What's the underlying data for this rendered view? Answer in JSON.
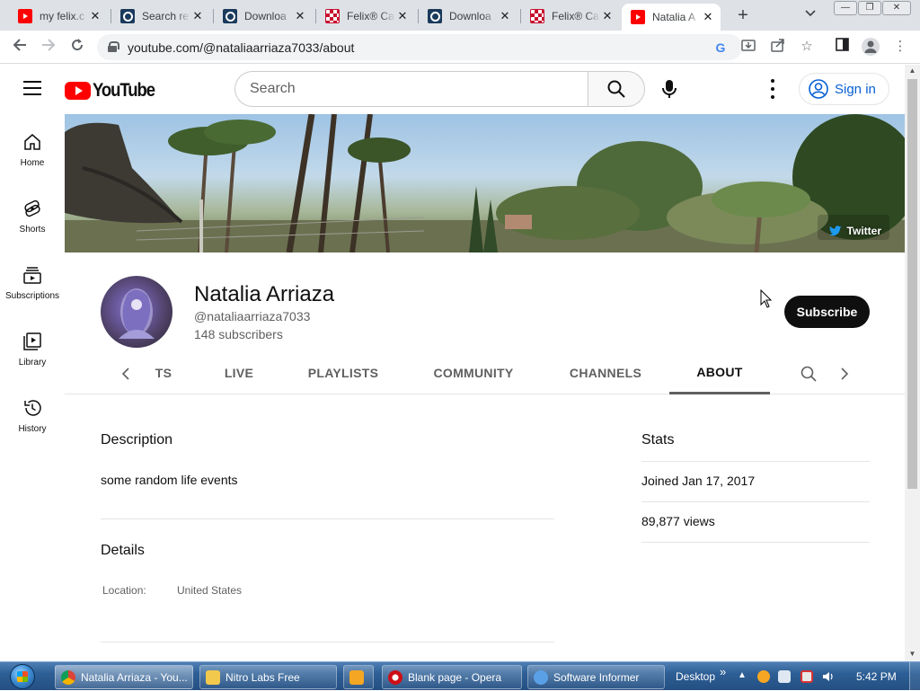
{
  "browser": {
    "tabs": [
      {
        "title": "my felix.c",
        "favicon": "youtube-icon"
      },
      {
        "title": "Search re",
        "favicon": "search-site-icon"
      },
      {
        "title": "Downloa",
        "favicon": "search-site-icon"
      },
      {
        "title": "Felix® Ca",
        "favicon": "felix-icon"
      },
      {
        "title": "Downloa",
        "favicon": "search-site-icon"
      },
      {
        "title": "Felix® Ca",
        "favicon": "felix-icon"
      },
      {
        "title": "Natalia A",
        "favicon": "youtube-icon",
        "active": true
      }
    ],
    "url": "youtube.com/@nataliaarriaza7033/about"
  },
  "youtube": {
    "logo_text": "YouTube",
    "search_placeholder": "Search",
    "signin_label": "Sign in",
    "sidebar": [
      {
        "label": "Home",
        "icon": "home-icon"
      },
      {
        "label": "Shorts",
        "icon": "shorts-icon"
      },
      {
        "label": "Subscriptions",
        "icon": "subscriptions-icon"
      },
      {
        "label": "Library",
        "icon": "library-icon"
      },
      {
        "label": "History",
        "icon": "history-icon"
      }
    ]
  },
  "channel": {
    "banner_link": "Twitter",
    "name": "Natalia Arriaza",
    "handle": "@nataliaarriaza7033",
    "subscribers": "148 subscribers",
    "subscribe_label": "Subscribe",
    "tabs": [
      "TS",
      "LIVE",
      "PLAYLISTS",
      "COMMUNITY",
      "CHANNELS",
      "ABOUT"
    ],
    "active_tab": "ABOUT"
  },
  "about": {
    "description_title": "Description",
    "description": "some random life events",
    "details_title": "Details",
    "location_label": "Location:",
    "location_value": "United States",
    "stats_title": "Stats",
    "joined": "Joined Jan 17, 2017",
    "views": "89,877 views"
  },
  "taskbar": {
    "items": [
      {
        "label": "Natalia Arriaza - You...",
        "active": true
      },
      {
        "label": "Nitro Labs Free"
      },
      {
        "label": "Blank page - Opera"
      },
      {
        "label": "Software Informer"
      }
    ],
    "desktop_label": "Desktop",
    "chevron": "»",
    "clock": "5:42 PM"
  },
  "colors": {
    "youtube_red": "#ff0000",
    "link_blue": "#065fd4",
    "subscribe_bg": "#0f0f0f",
    "taskbar": "#2d5f96"
  }
}
